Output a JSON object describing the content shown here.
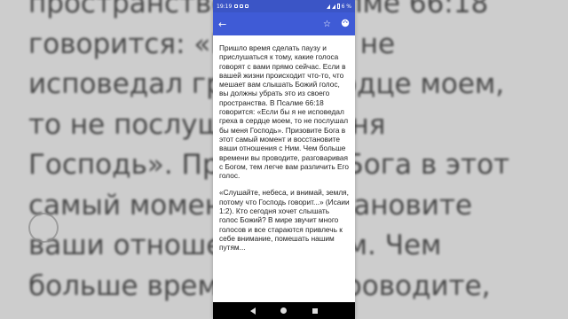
{
  "background": {
    "lines": [
      "пространстве… В Псалме 66:18",
      "говорится: «Если бы я не",
      "исповедал греха в сердце моем,",
      "то не послушал бы меня",
      "Господь». Призовите Бога в этот",
      "самый момент и восстановите",
      "ваши отношения с Ним. Чем",
      "больше времени вы проводите,"
    ]
  },
  "status_bar": {
    "time": "19:19",
    "battery": "6 %"
  },
  "app_bar": {
    "back_icon": "arrow-left",
    "bookmark_icon": "star",
    "theme_icon": "palette"
  },
  "article": {
    "paragraphs": [
      "Пришло время сделать паузу и прислушаться к тому, какие голоса говорят с вами прямо сейчас. Если в вашей жизни происходит что-то, что мешает вам слышать Божий голос, вы должны убрать это из своего пространства. В Псалме 66:18 говорится: «Если бы я не исповедал греха в сердце моем, то не послушал бы меня Господь». Призовите Бога в этот самый момент и восстановите ваши отношения с Ним. Чем больше времени вы проводите, разговаривая с Богом, тем легче вам различить Его голос.",
      "«Слушайте, небеса, и внимай, земля, потому что Господь говорит...» (Исаии 1:2). Кто сегодня хочет слышать голос Божий? В мире звучит много голосов и все стараются привлечь к себе внимание, помешать нашим путям..."
    ]
  },
  "colors": {
    "status_bar": "#3b55c6",
    "app_bar": "#3f5bd6",
    "nav_bar": "#000000"
  }
}
